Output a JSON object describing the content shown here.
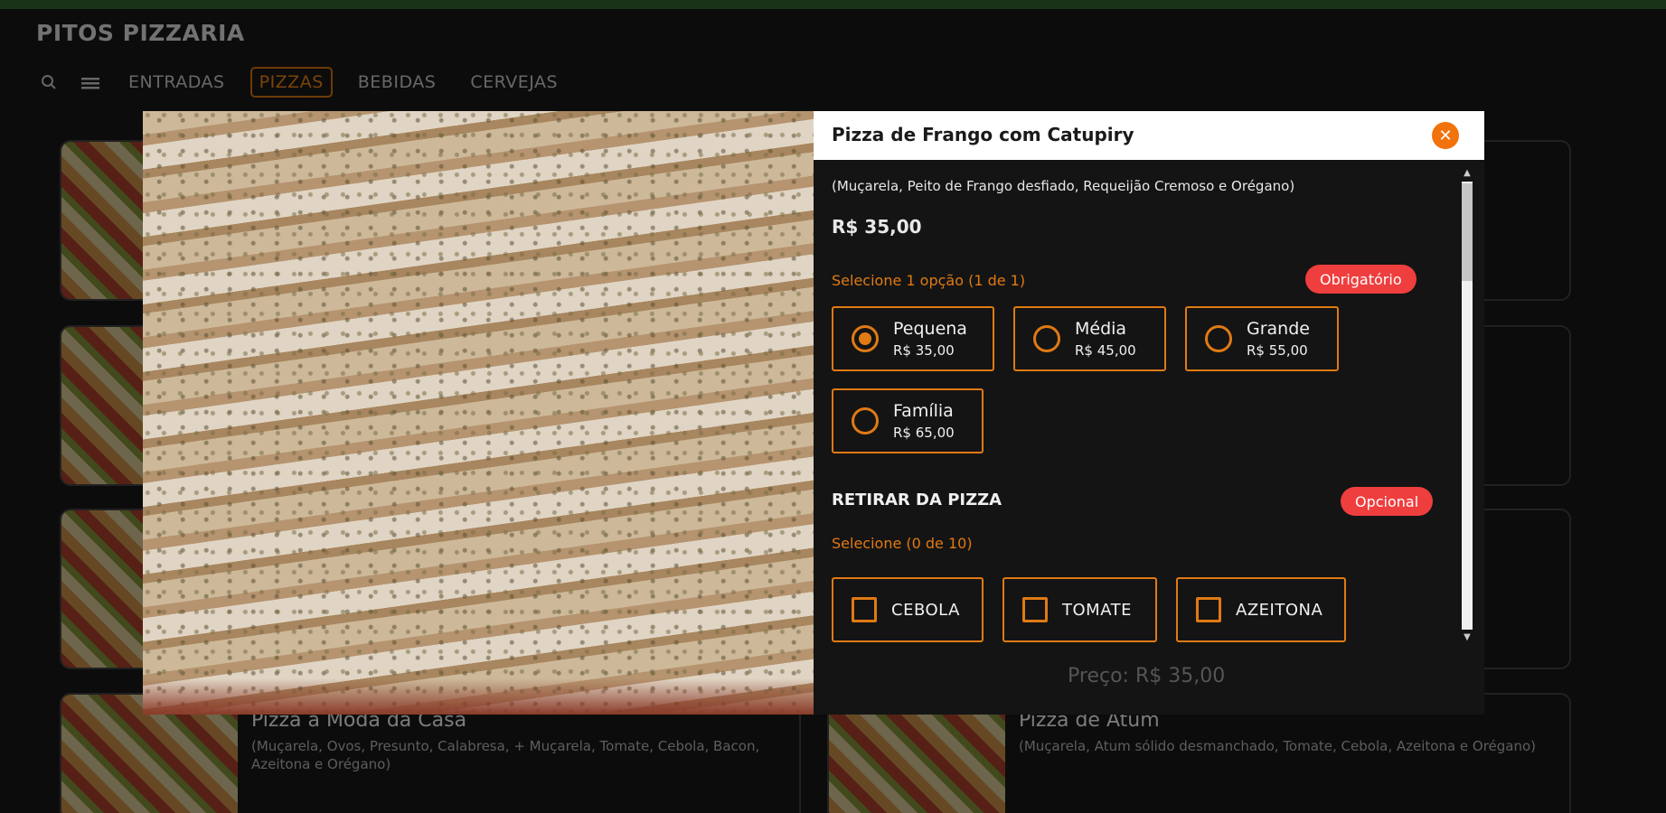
{
  "app": {
    "title": "PITOS PIZZARIA"
  },
  "nav": {
    "search_icon": "search-icon",
    "menu_icon": "menu-icon",
    "categories": [
      {
        "label": "ENTRADAS",
        "active": false
      },
      {
        "label": "PIZZAS",
        "active": true
      },
      {
        "label": "BEBIDAS",
        "active": false
      },
      {
        "label": "CERVEJAS",
        "active": false
      }
    ]
  },
  "background_cards": [
    {
      "name": "Pizza à Moda da Casa",
      "description": "(Muçarela, Ovos, Presunto, Calabresa, + Muçarela, Tomate, Cebola, Bacon, Azeitona e Orégano)"
    },
    {
      "name": "Pizza de Atum",
      "description": "(Muçarela, Atum sólido desmanchado, Tomate, Cebola, Azeitona e Orégano)"
    }
  ],
  "modal": {
    "title": "Pizza de Frango com Catupiry",
    "description": "(Muçarela, Peito de Frango desfiado, Requeijão Cremoso e Orégano)",
    "price": "R$ 35,00",
    "size_section": {
      "hint": "Selecione 1 opção (1 de 1)",
      "badge": "Obrigatório",
      "options": [
        {
          "name": "Pequena",
          "price": "R$ 35,00",
          "selected": true
        },
        {
          "name": "Média",
          "price": "R$ 45,00",
          "selected": false
        },
        {
          "name": "Grande",
          "price": "R$ 55,00",
          "selected": false
        },
        {
          "name": "Família",
          "price": "R$ 65,00",
          "selected": false
        }
      ]
    },
    "remove_section": {
      "title": "RETIRAR DA PIZZA",
      "badge": "Opcional",
      "hint": "Selecione (0 de 10)",
      "options": [
        {
          "label": "CEBOLA",
          "checked": false
        },
        {
          "label": "TOMATE",
          "checked": false
        },
        {
          "label": "AZEITONA",
          "checked": false
        }
      ]
    },
    "footer_price": "Preço: R$ 35,00"
  },
  "colors": {
    "accent": "#e07a14",
    "badge": "#ef3e3e",
    "close": "#f2720c",
    "background": "#161616"
  }
}
